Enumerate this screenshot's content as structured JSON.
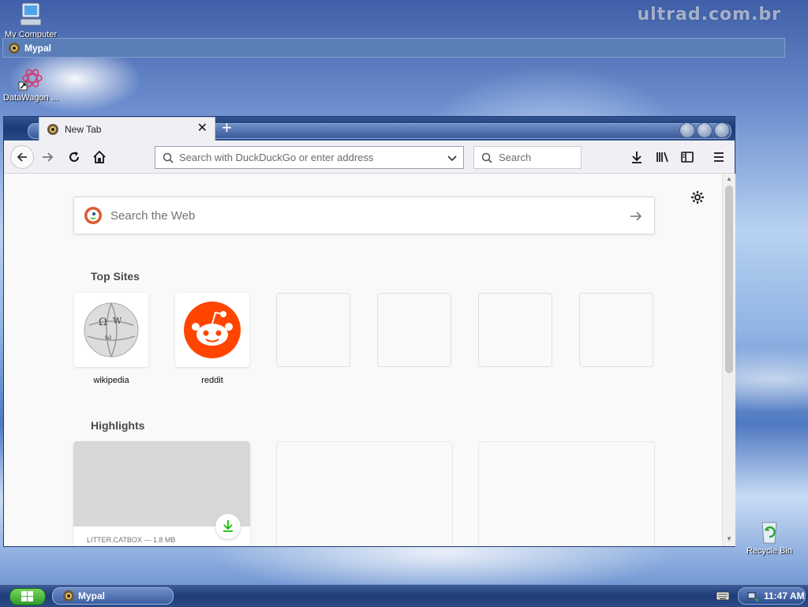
{
  "desktop": {
    "watermark": "ultrad.com.br",
    "icons": [
      {
        "label": "My Computer"
      },
      {
        "label": "DataWagon ..."
      },
      {
        "label": "Recycle Bin"
      }
    ]
  },
  "top_panel": {
    "title": "Mypal"
  },
  "browser": {
    "tab": {
      "title": "New Tab"
    },
    "urlbar": {
      "placeholder": "Search with DuckDuckGo or enter address"
    },
    "searchbar": {
      "placeholder": "Search"
    }
  },
  "newtab": {
    "search_placeholder": "Search the Web",
    "top_sites_title": "Top Sites",
    "top_sites": [
      {
        "label": "wikipedia"
      },
      {
        "label": "reddit"
      }
    ],
    "highlights_title": "Highlights",
    "highlight_card": {
      "meta": "LITTER.CATBOX — 1.8 MB"
    }
  },
  "taskbar": {
    "task_label": "Mypal",
    "clock": "11:47 AM"
  },
  "colors": {
    "reddit_orange": "#ff4500",
    "download_green": "#12bc00",
    "taskbar_blue": "#1f3c78"
  }
}
